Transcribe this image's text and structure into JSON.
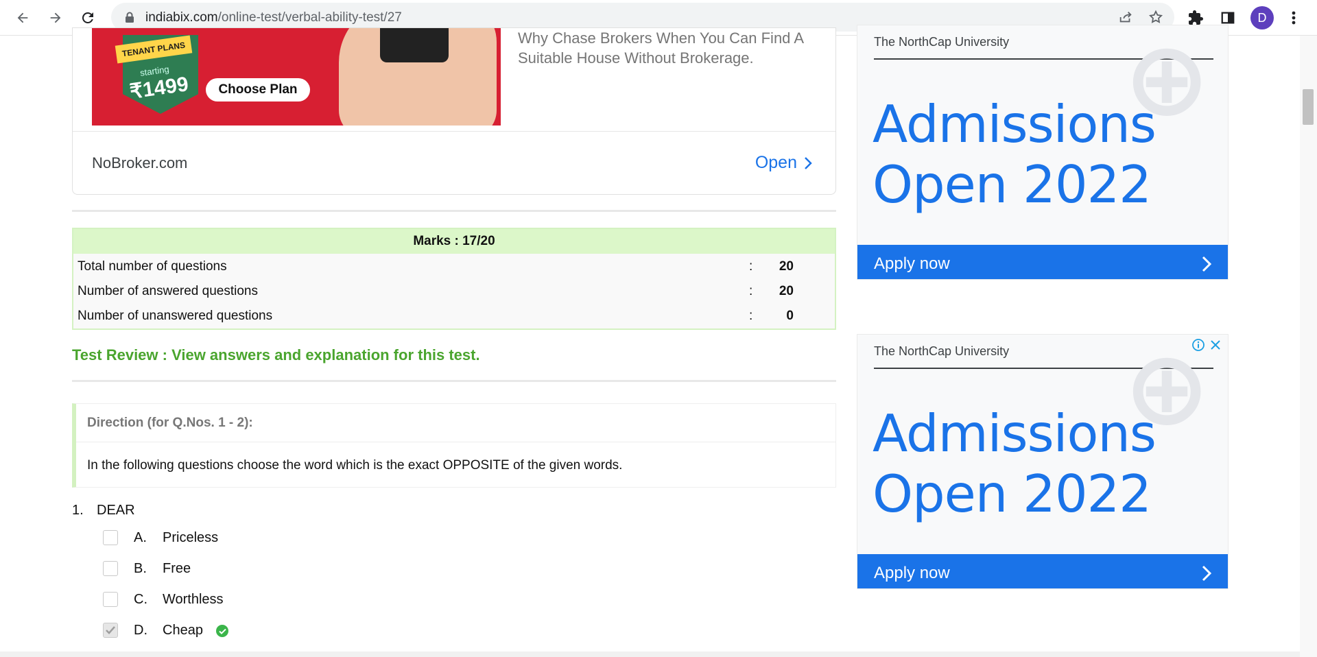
{
  "browser": {
    "url_domain": "indiabix.com",
    "url_path": "/online-test/verbal-ability-test/27",
    "profile_initial": "D",
    "icons": [
      "back-icon",
      "forward-icon",
      "reload-icon",
      "lock-icon",
      "share-icon",
      "star-icon",
      "extensions-icon",
      "sidepanel-icon",
      "menu-icon"
    ]
  },
  "top_ad": {
    "badge_title": "TENANT PLANS",
    "badge_small": "starting",
    "badge_price": "₹1499",
    "plan_button": "Choose Plan",
    "tagline": "Why Chase Brokers When You Can Find A Suitable House Without Brokerage.",
    "brand": "NoBroker.com",
    "open_label": "Open"
  },
  "marks": {
    "heading": "Marks : 17/20",
    "rows": [
      {
        "label": "Total number of questions",
        "colon": ":",
        "value": "20"
      },
      {
        "label": "Number of answered questions",
        "colon": ":",
        "value": "20"
      },
      {
        "label": "Number of unanswered questions",
        "colon": ":",
        "value": "0"
      }
    ]
  },
  "review_link": "Test Review : View answers and explanation for this test.",
  "direction": {
    "title": "Direction (for Q.Nos. 1 - 2):",
    "text": "In the following questions choose the word which is the exact OPPOSITE of the given words."
  },
  "question": {
    "number": "1.",
    "text": "DEAR",
    "options": [
      {
        "letter": "A.",
        "text": "Priceless",
        "checked": false
      },
      {
        "letter": "B.",
        "text": "Free",
        "checked": false
      },
      {
        "letter": "C.",
        "text": "Worthless",
        "checked": false
      },
      {
        "letter": "D.",
        "text": "Cheap",
        "checked": true
      }
    ]
  },
  "side_ads": [
    {
      "university": "The NorthCap University",
      "headline_line1": "Admissions",
      "headline_line2": "Open 2022",
      "apply": "Apply now"
    },
    {
      "university": "The NorthCap University",
      "headline_line1": "Admissions",
      "headline_line2": "Open 2022",
      "apply": "Apply now"
    }
  ],
  "colors": {
    "accent_blue": "#1a73e8",
    "review_green": "#4aa52e",
    "marks_header_bg": "#dcf7c9",
    "ad_red": "#d71f32"
  }
}
